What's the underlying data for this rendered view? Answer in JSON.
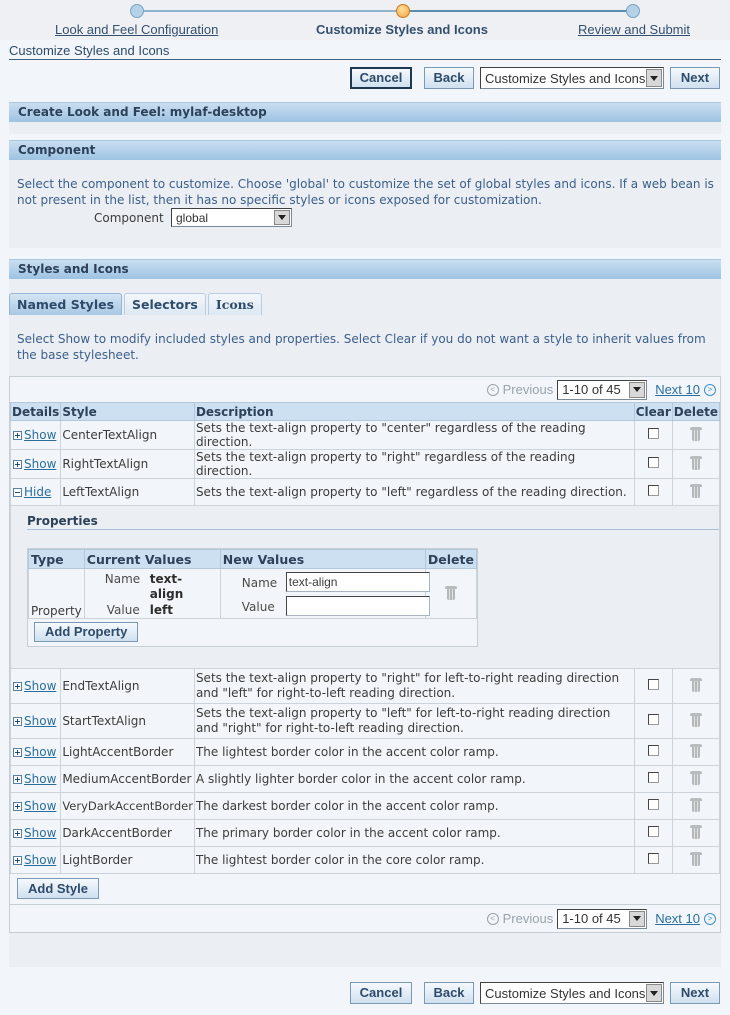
{
  "train": {
    "steps": [
      {
        "label": "Look and Feel Configuration",
        "state": "done"
      },
      {
        "label": "Customize Styles and Icons",
        "state": "current"
      },
      {
        "label": "Review and Submit",
        "state": "todo"
      }
    ]
  },
  "page_title": "Customize Styles and Icons",
  "nav": {
    "cancel": "Cancel",
    "back": "Back",
    "step_select": "Customize Styles and Icons",
    "next": "Next"
  },
  "header_section": {
    "title": "Create Look and Feel: mylaf-desktop"
  },
  "component_section": {
    "title": "Component",
    "help": "Select the component to customize. Choose 'global' to customize the set of global styles and icons. If a web bean is not present in the list, then it has no specific styles or icons exposed for customization.",
    "field_label": "Component",
    "field_value": "global"
  },
  "styles_section": {
    "title": "Styles and Icons",
    "tabs": [
      {
        "label": "Named Styles",
        "active": true
      },
      {
        "label": "Selectors",
        "active": false
      },
      {
        "label": "Icons",
        "active": false
      }
    ],
    "help": "Select Show to modify included styles and properties. Select Clear if you do not want a style to inherit values from the base stylesheet."
  },
  "pager": {
    "previous": "Previous",
    "range": "1-10 of 45",
    "next": "Next 10"
  },
  "table": {
    "columns": [
      "Details",
      "Style",
      "Description",
      "Clear",
      "Delete"
    ],
    "rows": [
      {
        "toggle": "Show",
        "style": "CenterTextAlign",
        "description": "Sets the text-align property to \"center\" regardless of the reading direction."
      },
      {
        "toggle": "Show",
        "style": "RightTextAlign",
        "description": "Sets the text-align property to \"right\" regardless of the reading direction."
      },
      {
        "toggle": "Hide",
        "style": "LeftTextAlign",
        "description": "Sets the text-align property to \"left\" regardless of the reading direction."
      },
      {
        "toggle": "Show",
        "style": "EndTextAlign",
        "description": "Sets the text-align property to \"right\" for left-to-right reading direction and \"left\" for right-to-left reading direction."
      },
      {
        "toggle": "Show",
        "style": "StartTextAlign",
        "description": "Sets the text-align property to \"left\" for left-to-right reading direction and \"right\" for right-to-left reading direction."
      },
      {
        "toggle": "Show",
        "style": "LightAccentBorder",
        "description": "The lightest border color in the accent color ramp."
      },
      {
        "toggle": "Show",
        "style": "MediumAccentBorder",
        "description": "A slightly lighter border color in the accent color ramp."
      },
      {
        "toggle": "Show",
        "style": "VeryDarkAccentBorder",
        "description": "The darkest border color in the accent color ramp."
      },
      {
        "toggle": "Show",
        "style": "DarkAccentBorder",
        "description": "The primary border color in the accent color ramp."
      },
      {
        "toggle": "Show",
        "style": "LightBorder",
        "description": "The lightest border color in the core color ramp."
      }
    ],
    "add_style": "Add Style"
  },
  "properties": {
    "title": "Properties",
    "columns": [
      "Type",
      "Current Values",
      "New Values",
      "Delete"
    ],
    "row": {
      "type": "Property",
      "current_name_label": "Name",
      "current_name": "text-align",
      "current_value_label": "Value",
      "current_value": "left",
      "new_name_label": "Name",
      "new_name": "text-align",
      "new_value_label": "Value",
      "new_value": ""
    },
    "add_property": "Add Property"
  }
}
